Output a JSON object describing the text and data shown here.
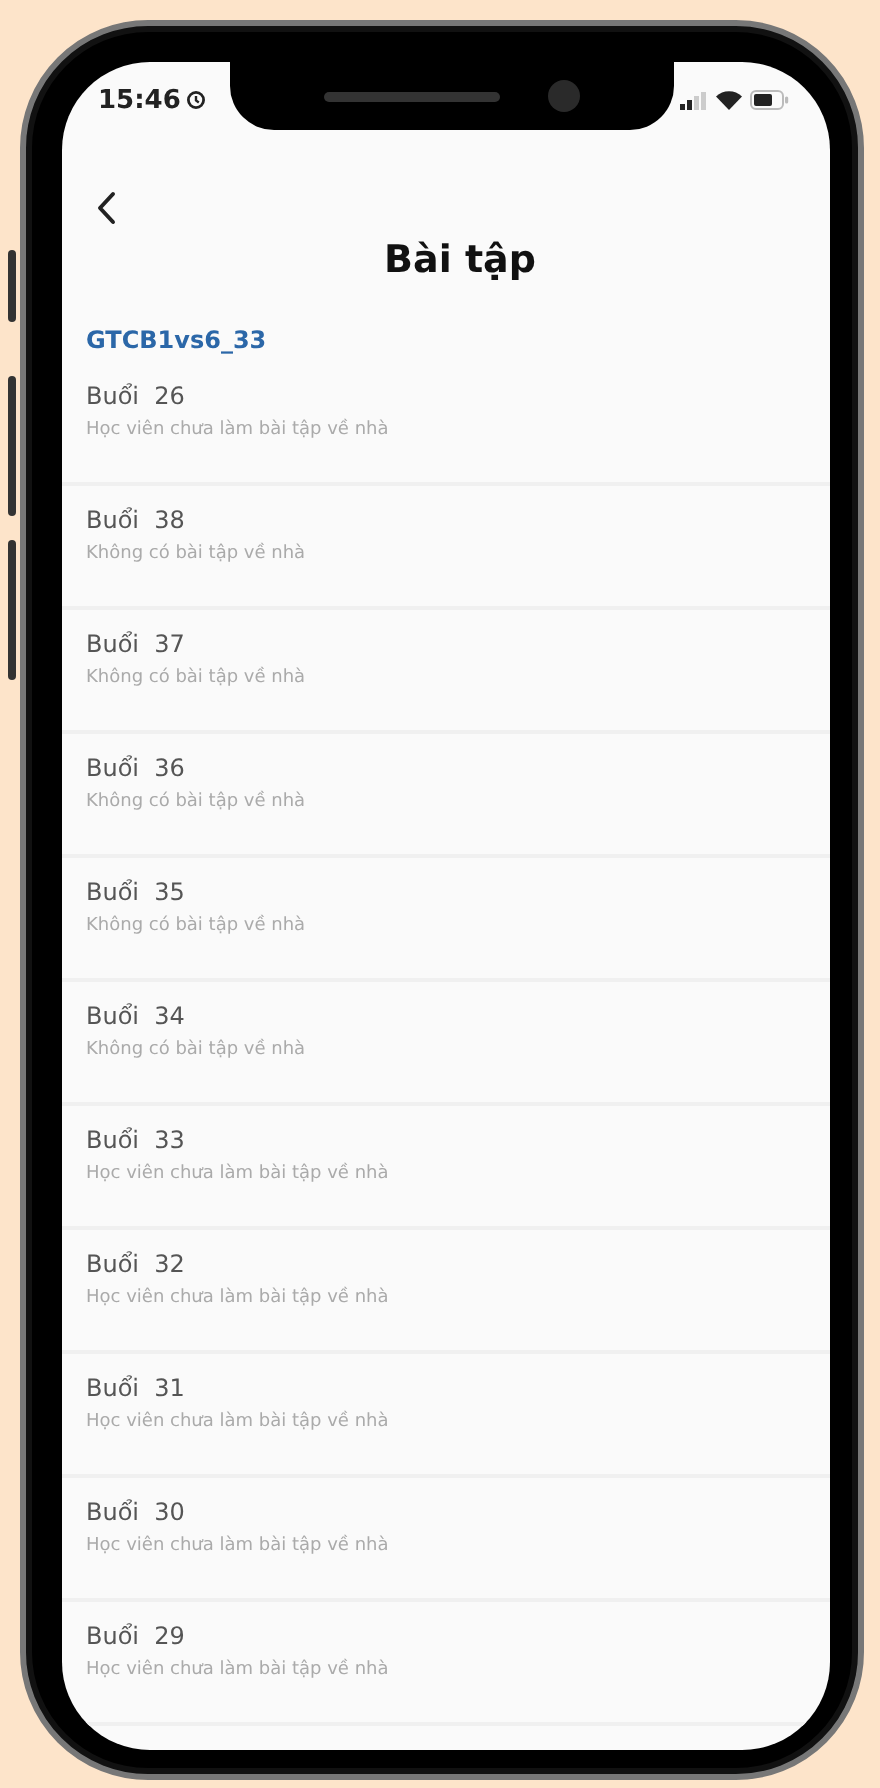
{
  "status_bar": {
    "time": "15:46"
  },
  "header": {
    "title": "Bài tập"
  },
  "group": {
    "label": "GTCB1vs6_33"
  },
  "sessions": [
    {
      "title": "Buổi  26",
      "note": "Học viên chưa làm bài tập về nhà"
    },
    {
      "title": "Buổi  38",
      "note": "Không có bài tập về nhà"
    },
    {
      "title": "Buổi  37",
      "note": "Không có bài tập về nhà"
    },
    {
      "title": "Buổi  36",
      "note": "Không có bài tập về nhà"
    },
    {
      "title": "Buổi  35",
      "note": "Không có bài tập về nhà"
    },
    {
      "title": "Buổi  34",
      "note": "Không có bài tập về nhà"
    },
    {
      "title": "Buổi  33",
      "note": "Học viên chưa làm bài tập về nhà"
    },
    {
      "title": "Buổi  32",
      "note": "Học viên chưa làm bài tập về nhà"
    },
    {
      "title": "Buổi  31",
      "note": "Học viên chưa làm bài tập về nhà"
    },
    {
      "title": "Buổi  30",
      "note": "Học viên chưa làm bài tập về nhà"
    },
    {
      "title": "Buổi  29",
      "note": "Học viên chưa làm bài tập về nhà"
    }
  ]
}
